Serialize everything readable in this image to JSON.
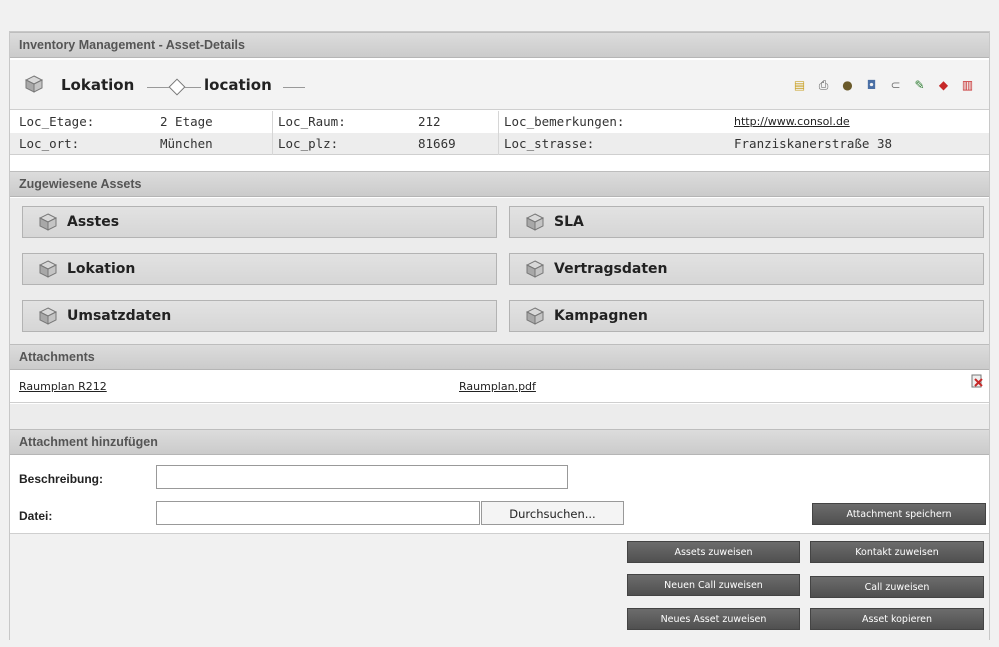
{
  "window": {
    "title": "Inventory Management - Asset-Details"
  },
  "asset_header": {
    "type_label": "Lokation",
    "name_label": "location",
    "tools": [
      {
        "name": "note-icon",
        "glyph": "▤",
        "color": "#c9a227"
      },
      {
        "name": "print-icon",
        "glyph": "⎙",
        "color": "#555555"
      },
      {
        "name": "pin-icon",
        "glyph": "●",
        "color": "#6a5a2a"
      },
      {
        "name": "copy-icon",
        "glyph": "◘",
        "color": "#4a6fa5"
      },
      {
        "name": "paperclip-icon",
        "glyph": "⊂",
        "color": "#777777"
      },
      {
        "name": "edit-icon",
        "glyph": "✎",
        "color": "#2e7d32"
      },
      {
        "name": "delete-icon",
        "glyph": "◆",
        "color": "#c62828"
      },
      {
        "name": "pdf-icon",
        "glyph": "▥",
        "color": "#c62828"
      }
    ]
  },
  "properties": {
    "row1": [
      {
        "label": "Loc_Etage:",
        "value": "2 Etage"
      },
      {
        "label": "Loc_Raum:",
        "value": "212"
      },
      {
        "label": "Loc_bemerkungen:",
        "value": "http://www.consol.de"
      }
    ],
    "row2": [
      {
        "label": "Loc_ort:",
        "value": "München"
      },
      {
        "label": "Loc_plz:",
        "value": "81669"
      },
      {
        "label": "Loc_strasse:",
        "value": "Franziskanerstraße 38"
      }
    ]
  },
  "assigned_assets": {
    "title": "Zugewiesene Assets",
    "items": [
      "Asstes",
      "SLA",
      "Lokation",
      "Vertragsdaten",
      "Umsatzdaten",
      "Kampagnen"
    ]
  },
  "attachments": {
    "title": "Attachments",
    "items": [
      {
        "description": "Raumplan R212",
        "file": "Raumplan.pdf"
      }
    ]
  },
  "add_attachment": {
    "title": "Attachment hinzufügen",
    "description_label": "Beschreibung:",
    "description_value": "",
    "file_label": "Datei:",
    "file_value": "",
    "browse_label": "Durchsuchen...",
    "save_label": "Attachment speichern"
  },
  "actions": {
    "assign_assets": "Assets zuweisen",
    "assign_contact": "Kontakt zuweisen",
    "assign_new_call": "Neuen Call zuweisen",
    "assign_call": "Call zuweisen",
    "assign_new_asset": "Neues Asset zuweisen",
    "copy_asset": "Asset kopieren"
  }
}
